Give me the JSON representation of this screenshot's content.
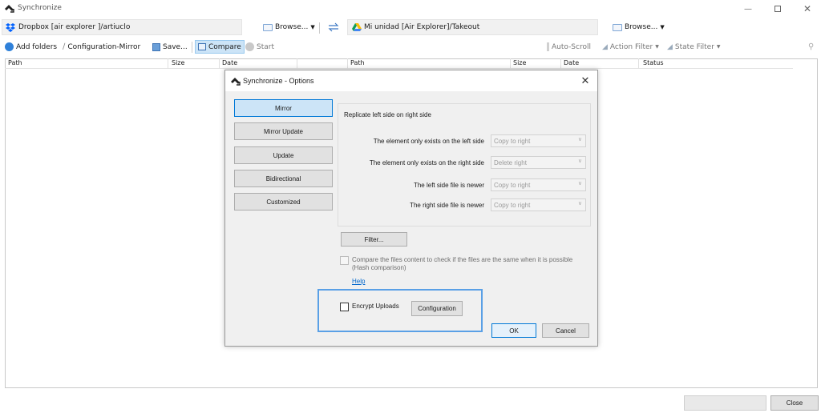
{
  "window": {
    "title": "Synchronize"
  },
  "left": {
    "path": "Dropbox [air explorer ]/artiuclo",
    "browse_label": "Browse..."
  },
  "right": {
    "path": "Mi unidad [Air Explorer]/Takeout",
    "browse_label": "Browse..."
  },
  "toolbar": {
    "add_folders": "Add folders",
    "configuration": "Configuration-Mirror",
    "save": "Save...",
    "compare": "Compare",
    "start": "Start",
    "auto_scroll": "Auto-Scroll",
    "action_filter": "Action Filter",
    "state_filter": "State Filter"
  },
  "columns": [
    "Path",
    "Size",
    "Date",
    "Path",
    "Size",
    "Date",
    "Status"
  ],
  "bottom": {
    "close_label": "Close"
  },
  "dialog": {
    "title": "Synchronize - Options",
    "modes": [
      "Mirror",
      "Mirror Update",
      "Update",
      "Bidirectional",
      "Customized"
    ],
    "selected_mode": "Mirror",
    "description": "Replicate left side on right side",
    "options": [
      {
        "label": "The element only exists on the left side",
        "value": "Copy to right"
      },
      {
        "label": "The element only exists on the right side",
        "value": "Delete right"
      },
      {
        "label": "The left side file is newer",
        "value": "Copy to right"
      },
      {
        "label": "The right side file is newer",
        "value": "Copy to right"
      }
    ],
    "filter_label": "Filter...",
    "compare_text": "Compare the files content to check if the files are the same when it is possible (Hash comparison)",
    "help_label": "Help",
    "encrypt_label": "Encrypt Uploads",
    "encrypt_checked": false,
    "configuration_label": "Configuration",
    "ok_label": "OK",
    "cancel_label": "Cancel"
  },
  "colors": {
    "accent": "#0078d7",
    "highlight_frame": "#5aa0e6",
    "selected_button": "#cce4f7"
  }
}
